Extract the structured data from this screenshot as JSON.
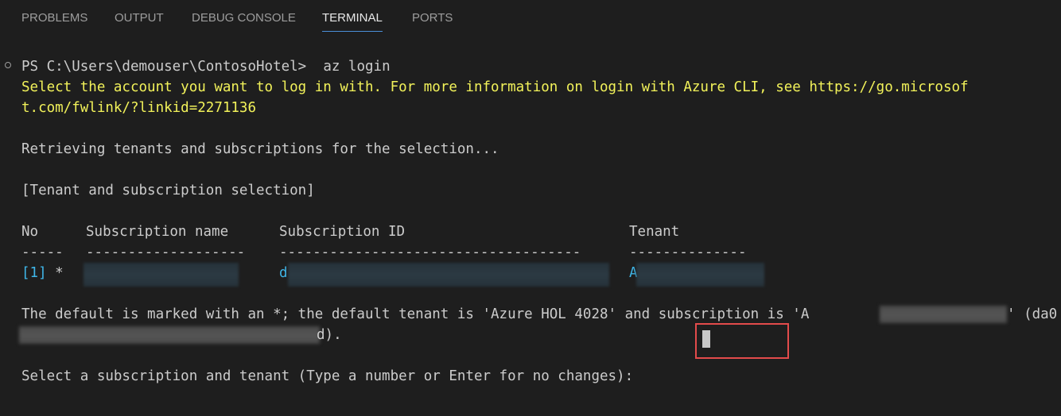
{
  "tabs": [
    {
      "label": "PROBLEMS",
      "active": false
    },
    {
      "label": "OUTPUT",
      "active": false
    },
    {
      "label": "DEBUG CONSOLE",
      "active": false
    },
    {
      "label": "TERMINAL",
      "active": true
    },
    {
      "label": "PORTS",
      "active": false
    }
  ],
  "terminal": {
    "prompt": "PS C:\\Users\\demouser\\ContosoHotel>",
    "command": "az login",
    "info_line1": "Select the account you want to log in with. For more information on login with Azure CLI, see https://go.microsof",
    "info_line2": "t.com/fwlink/?linkid=2271136",
    "retrieving": "Retrieving tenants and subscriptions for the selection...",
    "selection_header": "[Tenant and subscription selection]",
    "table": {
      "headers": {
        "no": "No",
        "subscription_name": "Subscription name",
        "subscription_id": "Subscription ID",
        "tenant": "Tenant"
      },
      "separators": {
        "no": "-----",
        "subscription_name": "-------------------",
        "subscription_id": "------------------------------------",
        "tenant": "--------------"
      },
      "rows": [
        {
          "no": "[1] *",
          "subscription_id_visible": "d",
          "tenant_visible": "A"
        }
      ]
    },
    "default_line1_a": "The default is marked with an *; the default tenant is 'Azure HOL 4028' and subscription is 'A",
    "default_line1_b": "' (da0",
    "default_line2_end": "d).",
    "select_prompt": "Select a subscription and tenant (Type a number or Enter for no changes):"
  },
  "colors": {
    "background": "#1e1e1e",
    "text": "#cccccc",
    "warning_yellow": "#f2f25a",
    "link_cyan": "#3fb6e8",
    "active_tab_underline": "#4a8fd8",
    "highlight_red": "#e34b4b"
  }
}
